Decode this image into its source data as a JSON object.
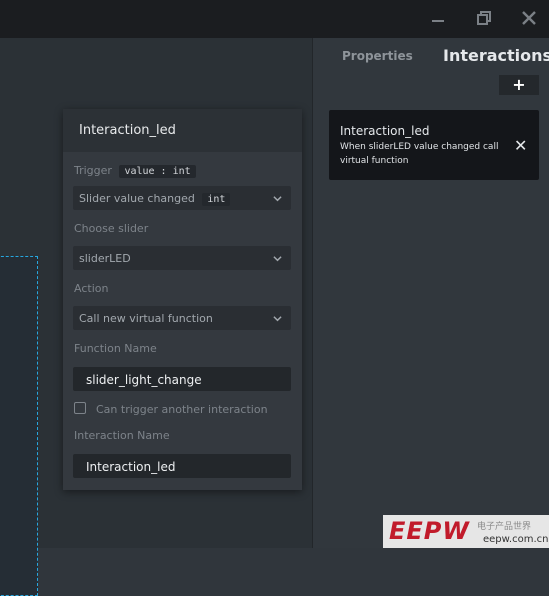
{
  "window": {
    "minimize_icon": "minimize-icon",
    "restore_icon": "restore-icon",
    "close_icon": "close-icon"
  },
  "right_panel": {
    "tabs": [
      {
        "label": "Properties",
        "active": false
      },
      {
        "label": "Interactions",
        "active": true
      }
    ],
    "add_label": "+",
    "interaction_card": {
      "title": "Interaction_led",
      "description": "When sliderLED value changed call virtual function",
      "close_label": "✕"
    }
  },
  "editor": {
    "title": "Interaction_led",
    "trigger": {
      "label": "Trigger",
      "chip": "value : int",
      "selected": "Slider value changed",
      "selected_chip": "int"
    },
    "choose_slider": {
      "label": "Choose slider",
      "selected": "sliderLED"
    },
    "action": {
      "label": "Action",
      "selected": "Call new virtual function"
    },
    "function_name": {
      "label": "Function Name",
      "value": "slider_light_change"
    },
    "can_trigger": {
      "label": "Can trigger another interaction",
      "checked": false
    },
    "interaction_name": {
      "label": "Interaction Name",
      "value": "Interaction_led"
    }
  },
  "watermark": {
    "logo": "EEPW",
    "chinese": "电子产品世界",
    "url": "eepw.com.cn"
  },
  "colors": {
    "titlebar": "#1b1d20",
    "canvas_background": "#2b3136",
    "selection_border": "#27a7df",
    "card_background": "#14161a",
    "watermark_red": "#c11b2b"
  }
}
